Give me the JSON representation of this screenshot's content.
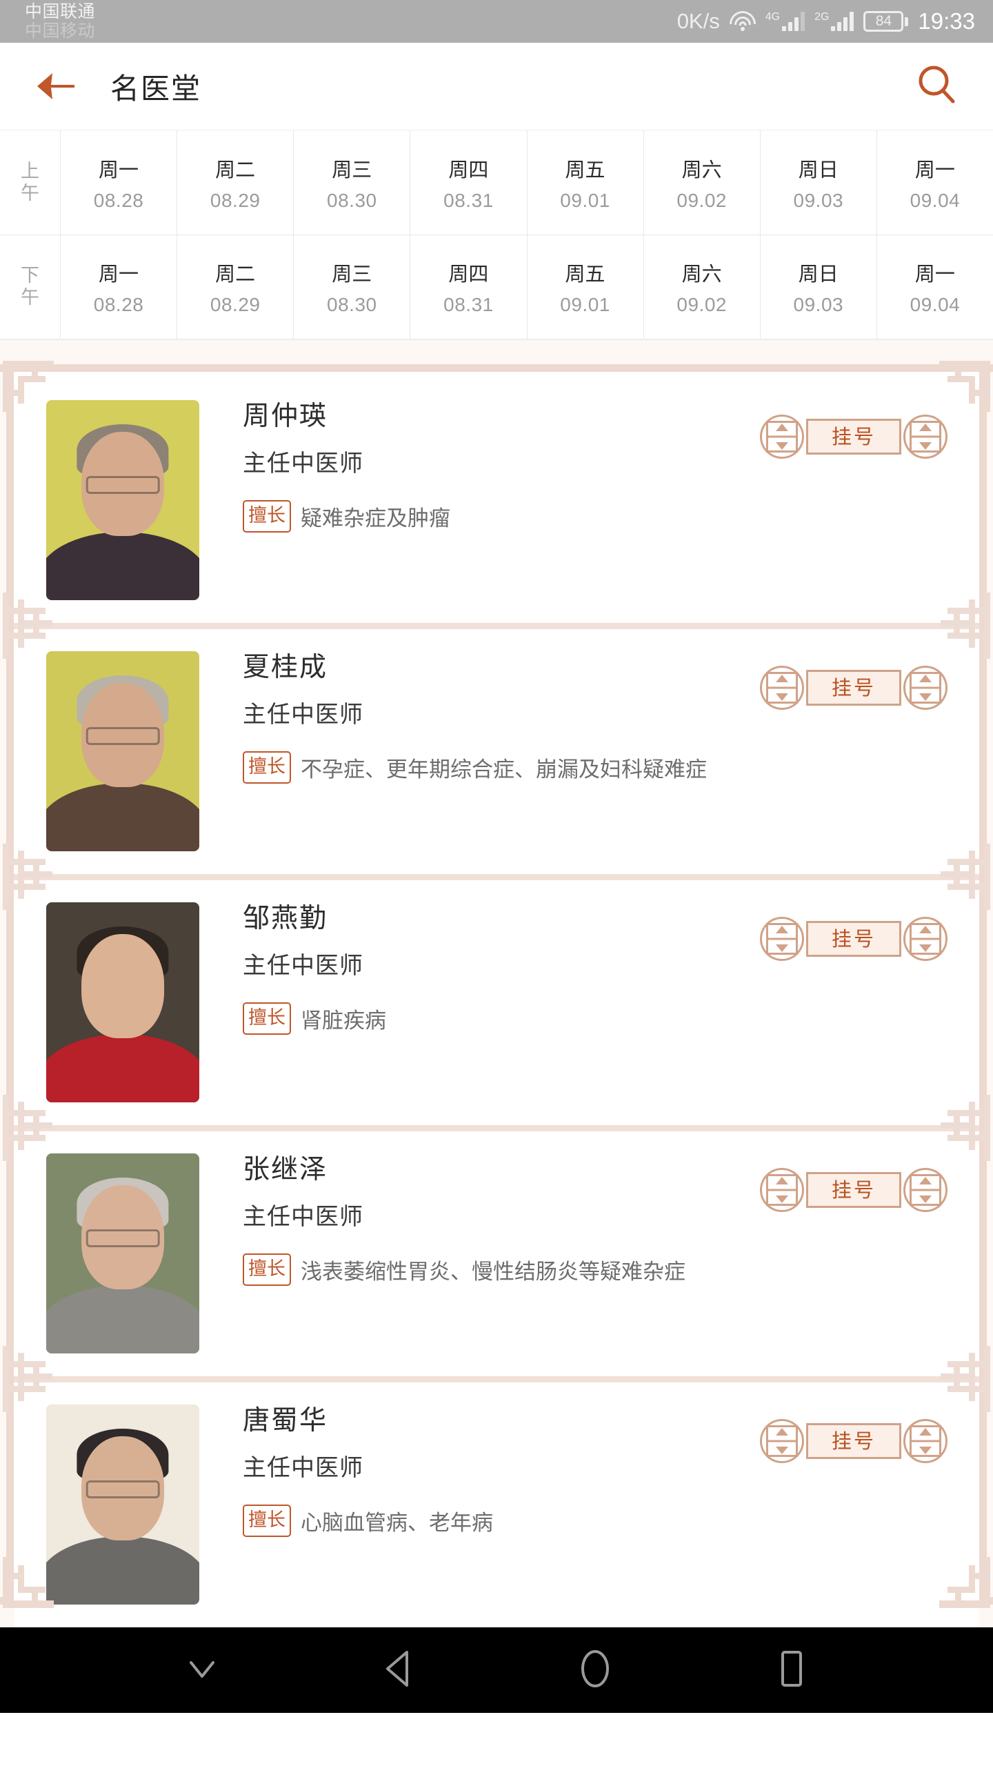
{
  "statusbar": {
    "carrier_primary": "中国联通",
    "carrier_secondary": "中国移动",
    "network_speed": "0K/s",
    "wifi_icon": "wifi-icon",
    "sim1_network": "4G",
    "sim2_network": "2G",
    "battery_level": "84",
    "time": "19:33",
    "bg_color": "#aeaeae"
  },
  "header": {
    "back_icon": "back-arrow-icon",
    "title": "名医堂",
    "search_icon": "search-icon",
    "accent_color": "#c0562a"
  },
  "schedule": {
    "rows": [
      {
        "period": "上午",
        "period_line1": "上",
        "period_line2": "午",
        "cells": [
          {
            "day": "周一",
            "date": "08.28"
          },
          {
            "day": "周二",
            "date": "08.29"
          },
          {
            "day": "周三",
            "date": "08.30"
          },
          {
            "day": "周四",
            "date": "08.31"
          },
          {
            "day": "周五",
            "date": "09.01"
          },
          {
            "day": "周六",
            "date": "09.02"
          },
          {
            "day": "周日",
            "date": "09.03"
          },
          {
            "day": "周一",
            "date": "09.04"
          }
        ]
      },
      {
        "period": "下午",
        "period_line1": "下",
        "period_line2": "午",
        "cells": [
          {
            "day": "周一",
            "date": "08.28"
          },
          {
            "day": "周二",
            "date": "08.29"
          },
          {
            "day": "周三",
            "date": "08.30"
          },
          {
            "day": "周四",
            "date": "08.31"
          },
          {
            "day": "周五",
            "date": "09.01"
          },
          {
            "day": "周六",
            "date": "09.02"
          },
          {
            "day": "周日",
            "date": "09.03"
          },
          {
            "day": "周一",
            "date": "09.04"
          }
        ]
      }
    ]
  },
  "doctors": {
    "skill_tag_label": "擅长",
    "register_label": "挂号",
    "items": [
      {
        "name": "周仲瑛",
        "title": "主任中医师",
        "skill": "疑难杂症及肿瘤",
        "avatar": {
          "bg": "#d4ce5c",
          "hair": "#8d8276",
          "skin": "#d6ab8d",
          "cloth": "#3b3038"
        }
      },
      {
        "name": "夏桂成",
        "title": "主任中医师",
        "skill": "不孕症、更年期综合症、崩漏及妇科疑难症",
        "avatar": {
          "bg": "#cfc95a",
          "hair": "#b9b2a6",
          "skin": "#d4a98c",
          "cloth": "#5b4438"
        }
      },
      {
        "name": "邹燕勤",
        "title": "主任中医师",
        "skill": "肾脏疾病",
        "avatar": {
          "bg": "#4a4139",
          "hair": "#2c2520",
          "skin": "#dcb294",
          "cloth": "#b8202a"
        }
      },
      {
        "name": "张继泽",
        "title": "主任中医师",
        "skill": "浅表萎缩性胃炎、慢性结肠炎等疑难杂症",
        "avatar": {
          "bg": "#7e8a6a",
          "hair": "#c9c4bd",
          "skin": "#d9b197",
          "cloth": "#8c8a84"
        }
      },
      {
        "name": "唐蜀华",
        "title": "主任中医师",
        "skill": "心脑血管病、老年病",
        "avatar": {
          "bg": "#efe9de",
          "hair": "#30292a",
          "skin": "#d7b094",
          "cloth": "#6c6a66"
        }
      }
    ]
  },
  "navbar": {
    "hide_icon": "chevron-down-icon",
    "back_icon": "nav-back-triangle-icon",
    "home_icon": "nav-home-circle-icon",
    "recents_icon": "nav-recents-square-icon"
  },
  "theme": {
    "accent": "#c0562a",
    "frame": "#edd9d0",
    "page_bg": "#fdf8f4",
    "card_bg": "#ffffff"
  }
}
